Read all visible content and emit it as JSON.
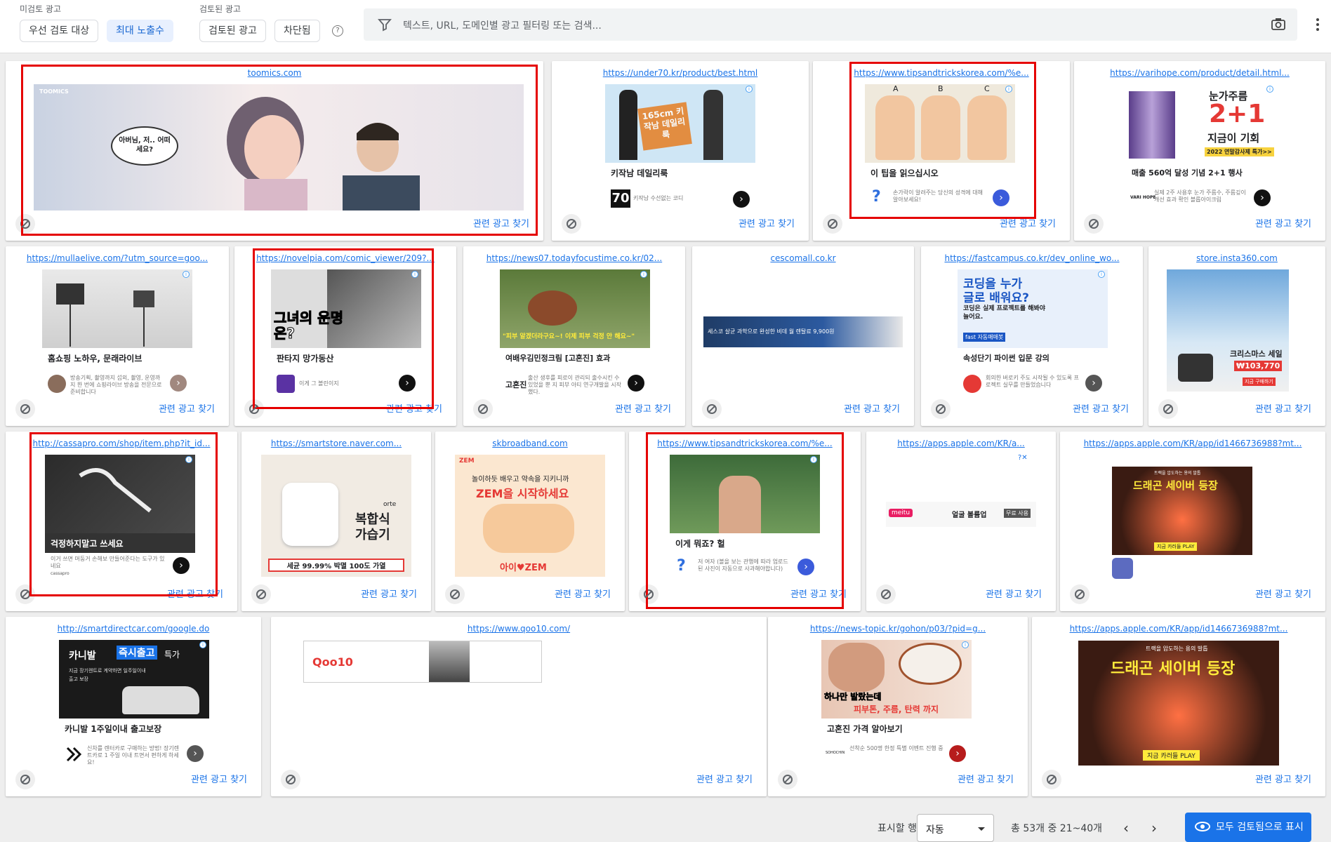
{
  "filters": {
    "unreviewed_label": "미검토 광고",
    "unreviewed_chips": [
      "우선 검토 대상",
      "최대 노출수"
    ],
    "reviewed_label": "검토된 광고",
    "reviewed_chips": [
      "검토된 광고",
      "차단됨"
    ],
    "help": "?"
  },
  "search": {
    "placeholder": "텍스트, URL, 도메인별 광고 필터링 또는 검색..."
  },
  "card_action": "관련 광고 찾기",
  "ads": [
    {
      "url": "toomics.com",
      "brand": "TOOMICS",
      "bubble": "아버님, 저.. 어떠세요?"
    },
    {
      "url": "https://under70.kr/product/best.html",
      "title": "키작남 데일리룩",
      "desc": "키작남 수선없는 코디",
      "badge": "70",
      "img_text": "165cm 키작남 데일리룩"
    },
    {
      "url": "https://www.tipsandtrickskorea.com/%e...",
      "title": "이 팁을 읽으십시오",
      "desc": "손가락이 알려주는 당신의 성격에 대해 알아보세요!",
      "img_labels": [
        "A",
        "B",
        "C"
      ]
    },
    {
      "url": "https://varihope.com/product/detail.html...",
      "title": "매출 560억 달성 기념 2+1 행사",
      "desc": "실제 2주 사용후 눈가 주름수, 주름깊이 개선 효과 확인 블롭아이크림",
      "img_line1": "눈가주름",
      "img_line2": "2+1",
      "img_line3": "지금이 기회",
      "img_line4": "2022 연말감사제 특가>>",
      "logo": "VARI HOPE"
    },
    {
      "url": "https://mullaelive.com/?utm_source=goo...",
      "title": "홈쇼핑 노하우, 문래라이브",
      "desc": "방송기획, 촬영까지 섭외, 촬영, 운영까지 한 번에 쇼핑라이브 방송을 전문으로 준비합니다"
    },
    {
      "url": "https://novelpia.com/comic_viewer/209?...",
      "title": "판타지 망가동산",
      "desc": "이게 그 볼린이지",
      "img_text": "그녀의 운명은?"
    },
    {
      "url": "https://news07.todayfocustime.co.kr/02...",
      "title": "여배우김민정크림 [고혼진] 효과",
      "desc": "출산 생후를 피로이 관리되 출수시킨 수 있었을 뿐 지 피부 아티 연구개발을 시작했다.",
      "img_text": "\"피부 알겠더라구요~! 이제 피부 걱정 안 해요~\"",
      "logo": "고혼진"
    },
    {
      "url": "cescomall.co.kr",
      "banner_text": "세스코 살균 과학으로 완성한 비데 월 렌탈료 9,900원"
    },
    {
      "url": "https://fastcampus.co.kr/dev_online_wo...",
      "title": "속성단기 파이썬 입문 강의",
      "desc": "회의한 버로키 주도 시작될 수 있도록 프로젝트 실무를 만들었습니다",
      "img_line1": "코딩을 누가",
      "img_line2": "글로 배워요?",
      "img_line3": "코딩은 실제 프로젝트를 해봐야 늘어요.",
      "img_tag": "fast 자동매매봇"
    },
    {
      "url": "store.insta360.com",
      "img_line1": "크리스마스 세일",
      "img_price": "₩103,770",
      "img_cta": "지금 구매하기"
    },
    {
      "url": "http://cassapro.com/shop/item.php?it_id...",
      "title": "걱정하지말고 쓰세요",
      "desc": "이거 쓰면 머둥거 손해보 만들어준다는 도구가 있네요",
      "logo": "cassapro"
    },
    {
      "url": "https://smartstore.naver.com...",
      "img_brand": "orte",
      "img_line1": "복합식",
      "img_line2": "가습기",
      "img_cta": "세균 99.99% 박멸 100도 가열"
    },
    {
      "url": "skbroadband.com",
      "img_line1": "놀이하듯 배우고 약속을 지키니까",
      "img_line2": "ZEM을 시작하세요",
      "img_logo": "아이♥ZEM",
      "img_tag": "ZEM"
    },
    {
      "url": "https://www.tipsandtrickskorea.com/%e...",
      "title": "이게 뭐죠? 헐",
      "desc": "저 여자 (볼을 보는 관행에 따라 업로드된 사진이 자동으로 사과해야합니다)"
    },
    {
      "url": "https://apps.apple.com/KR/a...",
      "brand": "meitu",
      "banner_text": "얼굴 볼륨업",
      "banner_cta": "무료 사용"
    },
    {
      "url": "https://apps.apple.com/KR/app/id1466736988?mt...",
      "img_line1": "드래곤 세이버 등장",
      "img_tag": "트랙을 압도하는 용의 발톱",
      "img_cta": "지금 카러들 PLAY"
    },
    {
      "url": "http://smartdirectcar.com/google.do",
      "title": "카니발 1주일이내 출고보장",
      "desc": "신차를 렌터카로 구매하는 방법! 장기렌트카로 1 주일 이내 트면서 편하게 하세요!",
      "img_line1": "카니발",
      "img_line2": "즉시출고",
      "img_line3": "특가",
      "img_line4": "지금 장기렌트로 계약하면 일주일이내 출고 보장"
    },
    {
      "url": "https://www.qoo10.com/",
      "brand": "Qoo10"
    },
    {
      "url": "https://news-topic.kr/gohon/p03/?pid=g...",
      "title": "고혼진 가격 알아보기",
      "desc": "선착순 500명 한정 특별 이벤트 진행 중",
      "img_line1": "하나만 발랐는데",
      "img_line2": "피부톤, 주름, 탄력 까지",
      "logo": "SOHOCHIN"
    },
    {
      "url": "https://apps.apple.com/KR/app/id1466736988?mt...",
      "img_line1": "드래곤 세이버 등장",
      "img_tag": "트랙을 압도하는 용의 발톱",
      "img_cta": "지금 카러들 PLAY"
    }
  ],
  "footer": {
    "rows_label": "표시할 행 수:",
    "rows_value": "자동",
    "range": "총 53개 중 21~40개",
    "prev": "‹",
    "next": "›",
    "mark_all": "모두 검토됨으로 표시"
  },
  "colors": {
    "accent": "#1a73e8",
    "highlight": "#e50000",
    "selected_chip": "#e8f0fe"
  }
}
